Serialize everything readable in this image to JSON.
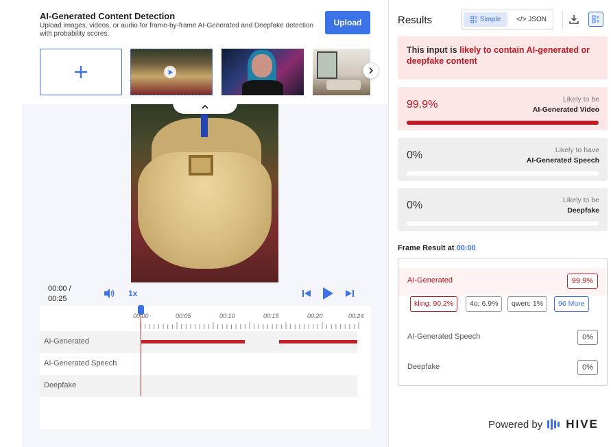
{
  "header": {
    "title": "AI-Generated Content Detection",
    "subtitle": "Upload images, videos, or audio for frame-by-frame AI-Generated and Deepfake detection with probability scores.",
    "upload_label": "Upload"
  },
  "gallery": {
    "add_icon": "plus-icon",
    "next_icon": "chevron-right-icon",
    "thumbnails": [
      "video-thumbnail-gown",
      "image-thumbnail-cyber-woman",
      "image-thumbnail-interior"
    ]
  },
  "player": {
    "time_current": "00:00 /",
    "time_total": "00:25",
    "speed": "1x",
    "playhead_progress": 0,
    "ticks": [
      "00:00",
      "00:05",
      "00:10",
      "00:15",
      "00:20",
      "00:24"
    ],
    "tracks": [
      {
        "label": "AI-Generated"
      },
      {
        "label": "AI-Generated Speech"
      },
      {
        "label": "Deepfake"
      }
    ],
    "ai_generated_segments": [
      {
        "from": 0.0,
        "to": 0.48
      },
      {
        "from": 0.64,
        "to": 1.0
      }
    ]
  },
  "results": {
    "title": "Results",
    "view_simple": "Simple",
    "view_json": "</> JSON",
    "verdict_prefix": "This input is ",
    "verdict_highlight": "likely to contain AI-generated or deepfake content",
    "cards": [
      {
        "percent": "99.9%",
        "line1": "Likely to be",
        "line2": "AI-Generated Video",
        "fill": 0.999
      },
      {
        "percent": "0%",
        "line1": "Likely to have",
        "line2": "AI-Generated Speech",
        "fill": 0
      },
      {
        "percent": "0%",
        "line1": "Likely to be",
        "line2": "Deepfake",
        "fill": 0
      }
    ],
    "frame_label": "Frame Result at ",
    "frame_time": "00:00",
    "frame_rows": [
      {
        "name": "AI-Generated",
        "value": "99.9%"
      },
      {
        "name": "AI-Generated Speech",
        "value": "0%"
      },
      {
        "name": "Deepfake",
        "value": "0%"
      }
    ],
    "chips": [
      "kling: 90.2%",
      "4o: 6.9%",
      "qwen: 1%",
      "96 More"
    ]
  },
  "footer": {
    "powered_by": "Powered by",
    "brand": "HIVE"
  },
  "colors": {
    "accent": "#3b73e6",
    "danger": "#c01a24"
  }
}
